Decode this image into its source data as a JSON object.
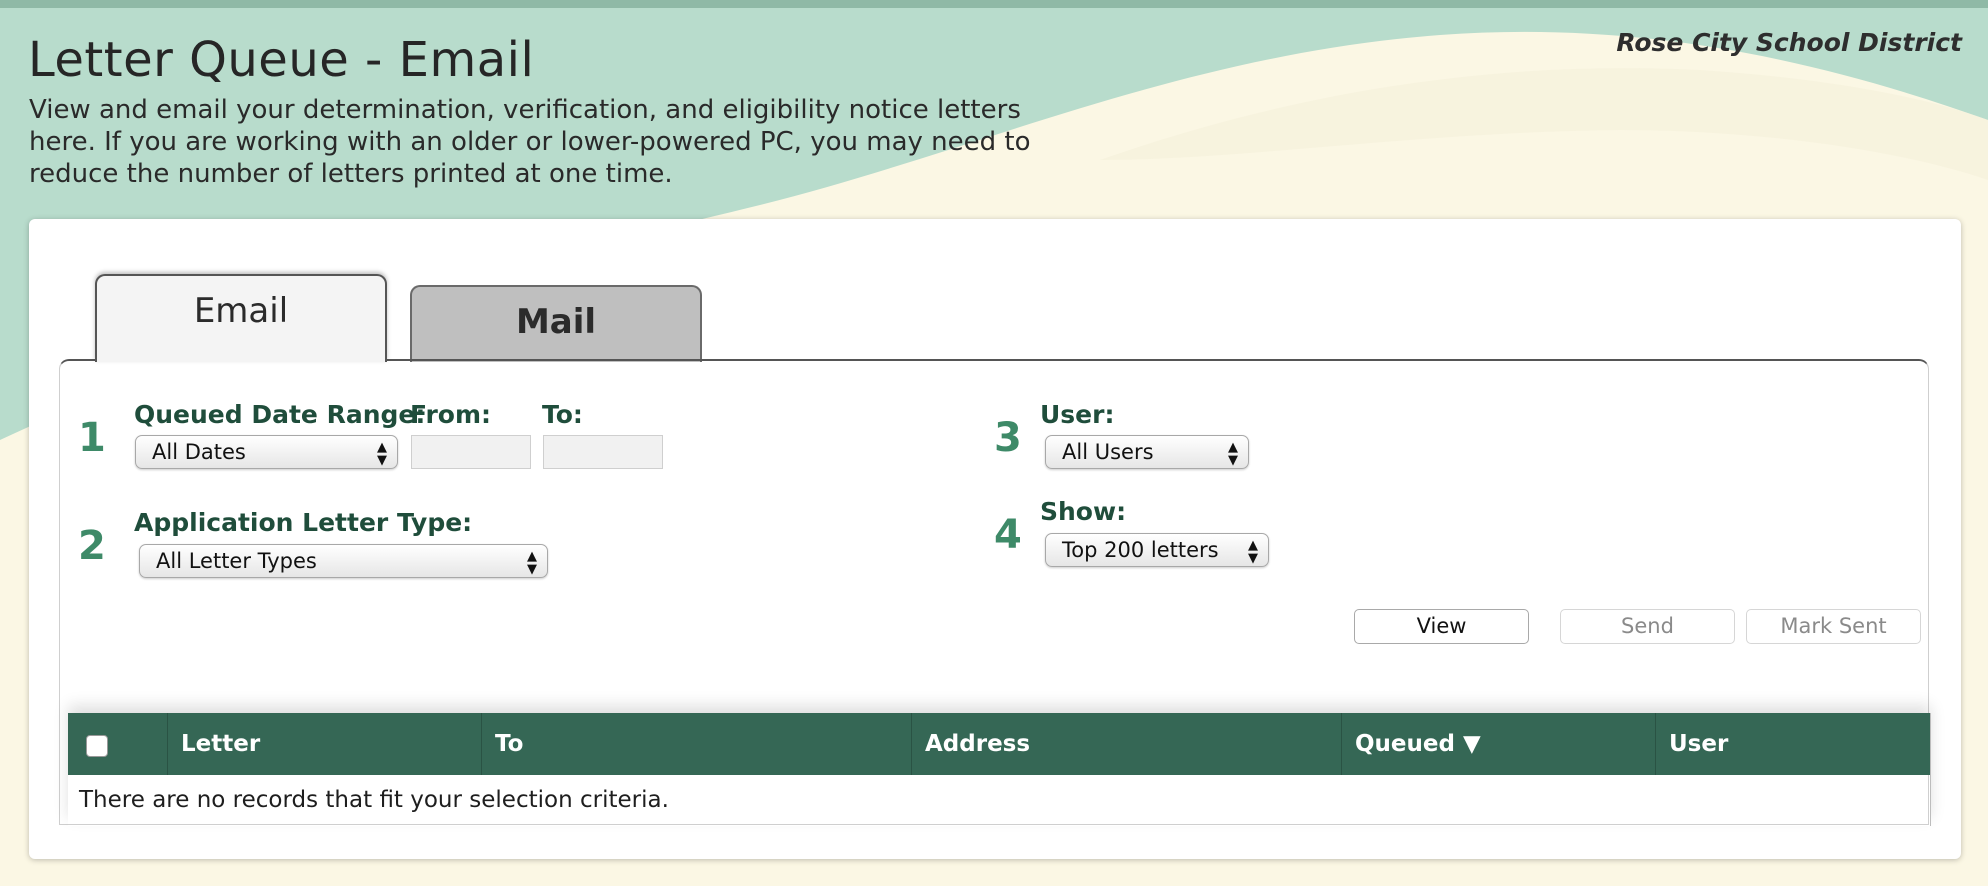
{
  "header": {
    "title": "Letter Queue - Email",
    "district": "Rose City School District",
    "description": "View and email your determination, verification, and eligibility notice letters here. If you are working with an older or lower-powered PC, you may need to reduce the number of letters printed at one time."
  },
  "tabs": {
    "email": "Email",
    "mail": "Mail",
    "active": "Email"
  },
  "filters": {
    "step1": "1",
    "step2": "2",
    "step3": "3",
    "step4": "4",
    "queued_date_label": "Queued Date Range:",
    "queued_date_value": "All Dates",
    "from_label": "From:",
    "to_label": "To:",
    "from_value": "",
    "to_value": "",
    "letter_type_label": "Application Letter Type:",
    "letter_type_value": "All Letter Types",
    "user_label": "User:",
    "user_value": "All Users",
    "show_label": "Show:",
    "show_value": "Top 200 letters"
  },
  "actions": {
    "view": "View",
    "send": "Send",
    "mark_sent": "Mark Sent"
  },
  "table": {
    "columns": [
      "Letter",
      "To",
      "Address",
      "Queued ▼",
      "User"
    ],
    "empty_message": "There are no records that fit your selection criteria."
  },
  "colors": {
    "header_wave": "#b8dccc",
    "cream": "#fbf7e4",
    "table_header": "#356755",
    "step_number": "#3e8a68",
    "label": "#1f4d3b"
  },
  "icons": {
    "select_arrows": "▲▼"
  }
}
